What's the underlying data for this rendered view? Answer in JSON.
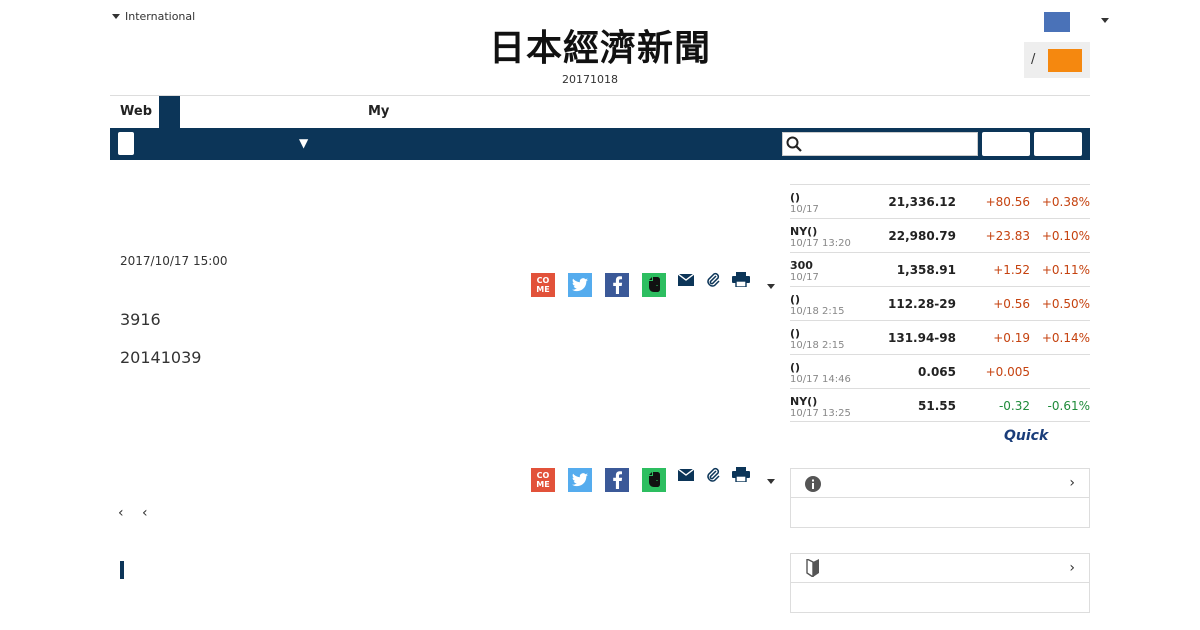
{
  "header": {
    "edition": "International",
    "logo_text": "日本經濟新聞",
    "date": "20171018",
    "slash": "/"
  },
  "tabs": {
    "web": "Web",
    "my": "My"
  },
  "nav": {
    "arrow": "▼",
    "search_placeholder": ""
  },
  "article": {
    "date": "2017/10/17 15:00",
    "come_label": "CO\nME",
    "paragraph1": "3916",
    "paragraph2": "20141039",
    "pager_prev": "‹",
    "pager_prev2": "‹"
  },
  "market": {
    "rows": [
      {
        "name": "()",
        "time": "10/17",
        "value": "21,336.12",
        "change": "+80.56",
        "pct": "+0.38%",
        "dir": "up"
      },
      {
        "name": "NY()",
        "time": "10/17 13:20",
        "value": "22,980.79",
        "change": "+23.83",
        "pct": "+0.10%",
        "dir": "up"
      },
      {
        "name": "300",
        "time": "10/17",
        "value": "1,358.91",
        "change": "+1.52",
        "pct": "+0.11%",
        "dir": "up"
      },
      {
        "name": "()",
        "time": "10/18 2:15",
        "value": "112.28-29",
        "change": "+0.56",
        "pct": "+0.50%",
        "dir": "up"
      },
      {
        "name": "()",
        "time": "10/18 2:15",
        "value": "131.94-98",
        "change": "+0.19",
        "pct": "+0.14%",
        "dir": "up"
      },
      {
        "name": "()",
        "time": "10/17 14:46",
        "value": "0.065",
        "change": "+0.005",
        "pct": "",
        "dir": "up"
      },
      {
        "name": "NY()",
        "time": "10/17 13:25",
        "value": "51.55",
        "change": "-0.32",
        "pct": "-0.61%",
        "dir": "down"
      }
    ],
    "source": "Quick"
  },
  "side": {
    "chevron": "›"
  },
  "colors": {
    "navy": "#0c3558",
    "orange": "#f5880f",
    "up": "#c5420f",
    "down": "#1f8b3a"
  }
}
